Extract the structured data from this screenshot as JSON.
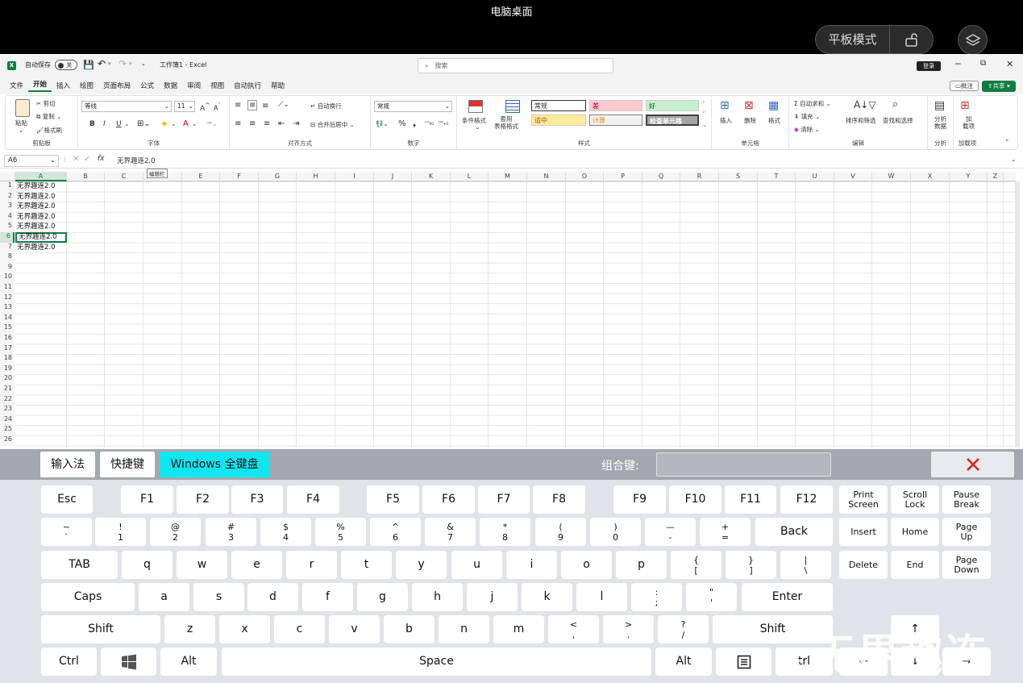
{
  "top": {
    "title": "电脑桌面",
    "tablet_mode": "平板模式"
  },
  "excel": {
    "autosave_label": "自动保存",
    "autosave_state": "关",
    "doc_title": "工作簿1  -  Excel",
    "search_placeholder": "搜索",
    "login": "登录",
    "menu": [
      "文件",
      "开始",
      "插入",
      "绘图",
      "页面布局",
      "公式",
      "数据",
      "审阅",
      "视图",
      "自动执行",
      "帮助"
    ],
    "comments": "批注",
    "share": "共享",
    "ribbon": {
      "paste": "粘贴",
      "cut": "剪切",
      "copy": "复制",
      "format_painter": "格式刷",
      "clipboard": "剪贴板",
      "font_name": "等线",
      "font_size": "11",
      "bold": "B",
      "italic": "I",
      "underline": "U",
      "font_group": "字体",
      "wrap": "自动换行",
      "merge": "合并后居中",
      "align_group": "对齐方式",
      "number_format": "常规",
      "number_group": "数字",
      "cond_format": "条件格式",
      "table_format": "套用\n表格格式",
      "styles": {
        "normal": "常规",
        "bad": "差",
        "good": "好",
        "neutral": "适中",
        "calc": "计算",
        "check": "检查单元格"
      },
      "styles_group": "样式",
      "insert": "插入",
      "delete": "删除",
      "format": "格式",
      "cells_group": "单元格",
      "autosum": "自动求和",
      "fill": "填充",
      "clear": "清除",
      "sort_filter": "排序和筛选",
      "find_select": "查找和选择",
      "edit_group": "编辑",
      "analyze": "分析\n数据",
      "analyze_group": "分析",
      "addins": "加\n载项",
      "addins_group": "加载项"
    },
    "name_box": "A6",
    "fx": "fx",
    "formula": "无界趣连2.0",
    "tooltip": "编辑栏",
    "columns": [
      "A",
      "B",
      "C",
      "D",
      "E",
      "F",
      "G",
      "H",
      "I",
      "J",
      "K",
      "L",
      "M",
      "N",
      "O",
      "P",
      "Q",
      "R",
      "S",
      "T",
      "U",
      "V",
      "W",
      "X",
      "Y",
      "Z"
    ],
    "rows": [
      "1",
      "2",
      "3",
      "4",
      "5",
      "6",
      "7",
      "8",
      "9",
      "10",
      "11",
      "12",
      "13",
      "14",
      "15",
      "16",
      "17",
      "18",
      "19",
      "20",
      "21",
      "22",
      "23",
      "24",
      "25",
      "26"
    ],
    "cells": [
      "无界趣连2.0",
      "无界趣连2.0",
      "无界趣连2.0",
      "无界趣连2.0",
      "无界趣连2.0",
      "无界趣连2.0",
      "无界趣连2.0"
    ]
  },
  "keyboard": {
    "tabs": {
      "ime": "输入法",
      "shortcut": "快捷键",
      "full": "Windows 全键盘"
    },
    "combo_label": "组合键:",
    "row0": [
      "Esc",
      "F1",
      "F2",
      "F3",
      "F4",
      "F5",
      "F6",
      "F7",
      "F8",
      "F9",
      "F10",
      "F11",
      "F12"
    ],
    "nav0": [
      "Print\nScreen",
      "Scroll\nLock",
      "Pause\nBreak"
    ],
    "row1": [
      [
        "~",
        "`"
      ],
      [
        "!",
        "1"
      ],
      [
        "@",
        "2"
      ],
      [
        "#",
        "3"
      ],
      [
        "$",
        "4"
      ],
      [
        "%",
        "5"
      ],
      [
        "^",
        "6"
      ],
      [
        "&",
        "7"
      ],
      [
        "*",
        "8"
      ],
      [
        "(",
        "9"
      ],
      [
        ")",
        "0"
      ],
      [
        "—",
        "-"
      ],
      [
        "+",
        "="
      ]
    ],
    "back": "Back",
    "nav1": [
      "Insert",
      "Home",
      "Page\nUp"
    ],
    "tab": "TAB",
    "row2": [
      "q",
      "w",
      "e",
      "r",
      "t",
      "y",
      "u",
      "i",
      "o",
      "p"
    ],
    "row2sym": [
      [
        "{",
        "["
      ],
      [
        "}",
        "]"
      ],
      [
        "|",
        "\\"
      ]
    ],
    "nav2": [
      "Delete",
      "End",
      "Page\nDown"
    ],
    "caps": "Caps",
    "row3": [
      "a",
      "s",
      "d",
      "f",
      "g",
      "h",
      "j",
      "k",
      "l"
    ],
    "row3sym": [
      [
        ":",
        ";"
      ],
      [
        "\"",
        "'"
      ]
    ],
    "enter": "Enter",
    "shift": "Shift",
    "row4": [
      "z",
      "x",
      "c",
      "v",
      "b",
      "n",
      "m"
    ],
    "row4sym": [
      [
        "<",
        ","
      ],
      [
        ">",
        "."
      ],
      [
        "?",
        "/"
      ]
    ],
    "ctrl": "Ctrl",
    "alt": "Alt",
    "space": "Space",
    "ctrl_r": "trl",
    "arrows": {
      "up": "↑",
      "down": "↓",
      "right": "→",
      "left": "←"
    },
    "watermark": "无界趣连"
  }
}
